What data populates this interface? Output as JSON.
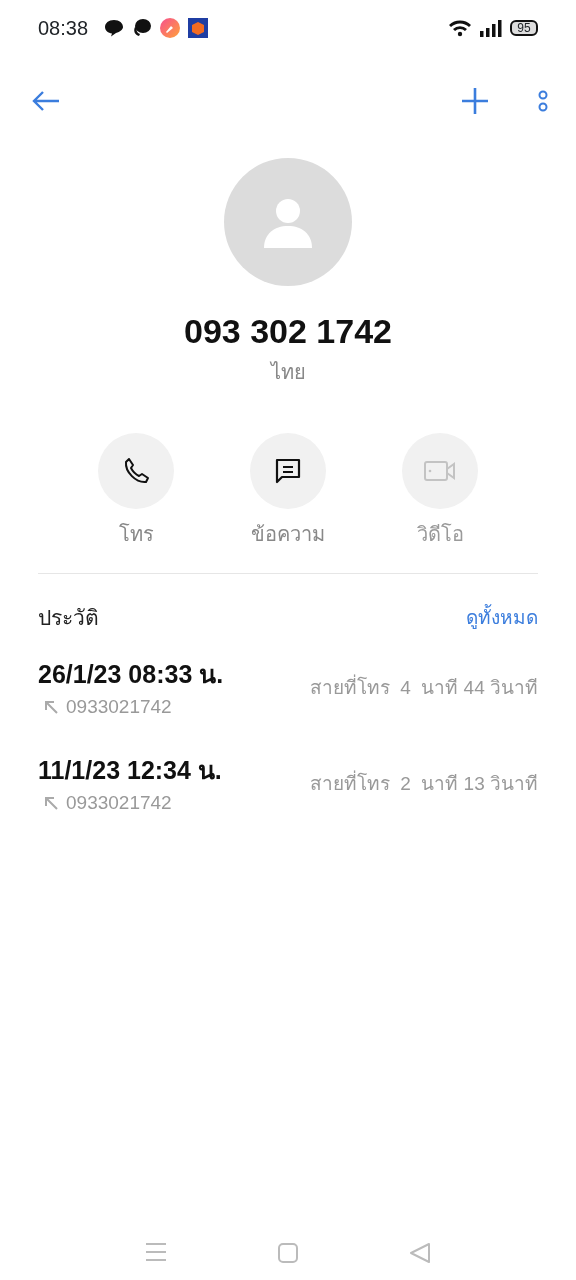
{
  "status_bar": {
    "time": "08:38",
    "battery": "95"
  },
  "contact": {
    "number": "093 302 1742",
    "region": "ไทย"
  },
  "actions": [
    {
      "kind": "call",
      "label": "โทร",
      "disabled": false
    },
    {
      "kind": "message",
      "label": "ข้อความ",
      "disabled": false
    },
    {
      "kind": "video",
      "label": "วิดีโอ",
      "disabled": true
    }
  ],
  "history": {
    "title": "ประวัติ",
    "link": "ดูทั้งหมด",
    "entries": [
      {
        "datetime": "26/1/23 08:33 น.",
        "number": "0933021742",
        "duration": "สายที่โทร  4  นาที 44 วินาที"
      },
      {
        "datetime": "11/1/23 12:34 น.",
        "number": "0933021742",
        "duration": "สายที่โทร  2  นาที 13 วินาที"
      }
    ]
  }
}
